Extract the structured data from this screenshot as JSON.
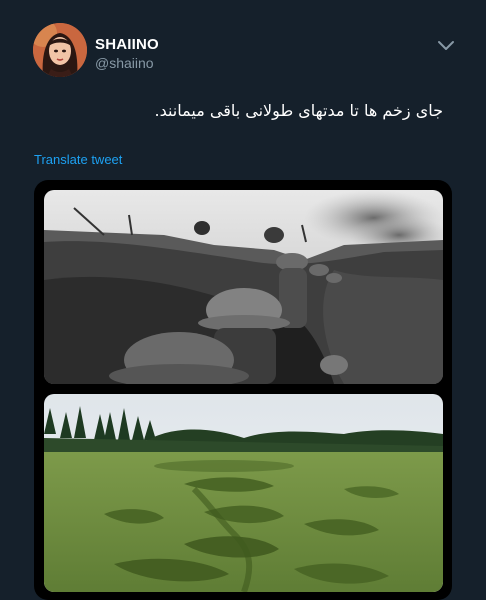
{
  "author": {
    "display_name": "SHAIINO",
    "handle": "@shaiino"
  },
  "icons": {
    "more": "chevron-down-icon",
    "avatar": "avatar"
  },
  "tweet": {
    "text": "جای زخم ها تا مدتهای طولانی باقی میمانند.",
    "translate_label": "Translate tweet"
  },
  "media": [
    {
      "kind": "photo",
      "subject": "black-and-white trench soldiers"
    },
    {
      "kind": "photo",
      "subject": "grassy field with trench scars and tree line"
    }
  ],
  "colors": {
    "background": "#15202b",
    "secondary_text": "#8899a6",
    "link": "#1da1f2"
  }
}
